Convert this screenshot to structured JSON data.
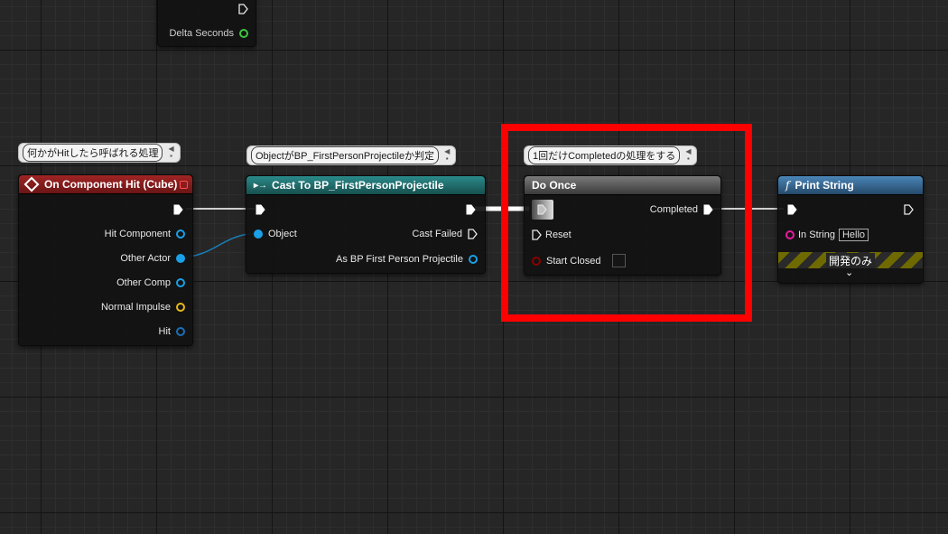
{
  "colors": {
    "event_header": "#8a1c1c",
    "cast_header": "#1f6f6f",
    "macro_header": "#5a5a5a",
    "function_header": "#3a6f9a",
    "object_pin": "#1aa0e8",
    "struct_pin": "#e8b81a",
    "bool_pin": "#8b0000",
    "string_pin": "#e81aa0",
    "float_pin": "#3ec43e",
    "highlight": "#ff0000"
  },
  "top_node": {
    "output_label": "Delta Seconds"
  },
  "event_node": {
    "title": "On Component Hit (Cube)",
    "comment": "何かがHitしたら呼ばれる処理",
    "outputs": [
      "Hit Component",
      "Other Actor",
      "Other Comp",
      "Normal Impulse",
      "Hit"
    ]
  },
  "cast_node": {
    "title": "Cast To BP_FirstPersonProjectile",
    "comment": "ObjectがBP_FirstPersonProjectileか判定",
    "input_label": "Object",
    "cast_failed_label": "Cast Failed",
    "as_label": "As BP First Person Projectile"
  },
  "doonce_node": {
    "title": "Do Once",
    "comment": "1回だけCompletedの処理をする",
    "completed_label": "Completed",
    "reset_label": "Reset",
    "start_closed_label": "Start Closed"
  },
  "print_node": {
    "title": "Print String",
    "in_string_label": "In String",
    "in_string_value": "Hello",
    "dev_only_label": "開発のみ"
  }
}
